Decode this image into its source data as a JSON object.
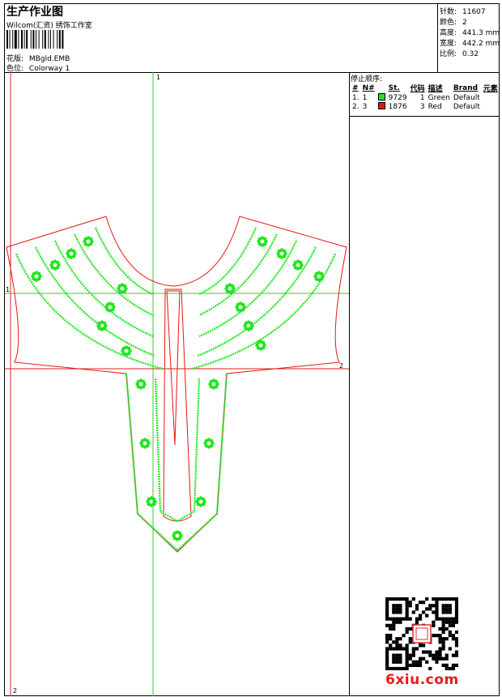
{
  "header": {
    "title": "生产作业图",
    "company": "Wilcom(汇资) 绣饰工作室",
    "design_label": "花版:",
    "design_value": "MBgld.EMB",
    "colorway_label": "色位:",
    "colorway_value": "Colorway 1"
  },
  "stats": [
    {
      "label": "针数:",
      "value": "11607"
    },
    {
      "label": "颜色:",
      "value": "2"
    },
    {
      "label": "高度:",
      "value": "441.3 mm"
    },
    {
      "label": "宽度:",
      "value": "442.2 mm"
    },
    {
      "label": "比例:",
      "value": "0.32"
    }
  ],
  "stop_sequence": {
    "title": "停止顺序:",
    "columns": [
      "#",
      "N#",
      "St.",
      "代码",
      "描述",
      "Brand",
      "元素"
    ],
    "rows": [
      {
        "seq": "1.",
        "n": "1",
        "color": "#1ee61e",
        "code": "9729",
        "stops": "1",
        "desc": "Green",
        "brand": "Default"
      },
      {
        "seq": "2.",
        "n": "3",
        "color": "#e81414",
        "code": "1876",
        "stops": "3",
        "desc": "Red",
        "brand": "Default"
      }
    ]
  },
  "markers": {
    "top": "1",
    "left": "1",
    "right": "2",
    "bottom": "2"
  },
  "watermark": "6xiu.com",
  "colors": {
    "green": "#1ee61e",
    "red": "#e81414",
    "guide_green": "#33cc33",
    "guide_red": "#dd2222"
  }
}
